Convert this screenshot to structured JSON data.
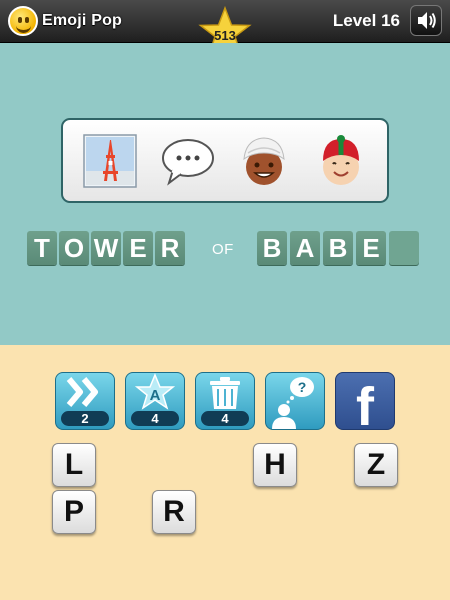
{
  "app": {
    "logo_text": "Emoji Pop",
    "score": "513",
    "level": "Level 16"
  },
  "puzzle": {
    "emojis": [
      "tokyo-tower",
      "speech-balloon",
      "man-with-turban",
      "man-with-gua-pi-mao"
    ],
    "answer": [
      {
        "word": [
          "T",
          "O",
          "W",
          "E",
          "R"
        ]
      },
      {
        "word": [
          "O",
          "F"
        ],
        "small": true
      },
      {
        "word": [
          "B",
          "A",
          "B",
          "E",
          ""
        ]
      }
    ]
  },
  "powerups": [
    {
      "name": "skip",
      "count": "2"
    },
    {
      "name": "reveal-letter",
      "count": "4"
    },
    {
      "name": "remove-letters",
      "count": "4"
    },
    {
      "name": "ask-friend",
      "count": ""
    },
    {
      "name": "facebook",
      "count": ""
    }
  ],
  "letters": [
    "L",
    "H",
    "Z",
    "P",
    "R"
  ],
  "colors": {
    "teal": "#92c9c6",
    "cream": "#fbe3b0",
    "tile": "#5a8a77"
  }
}
